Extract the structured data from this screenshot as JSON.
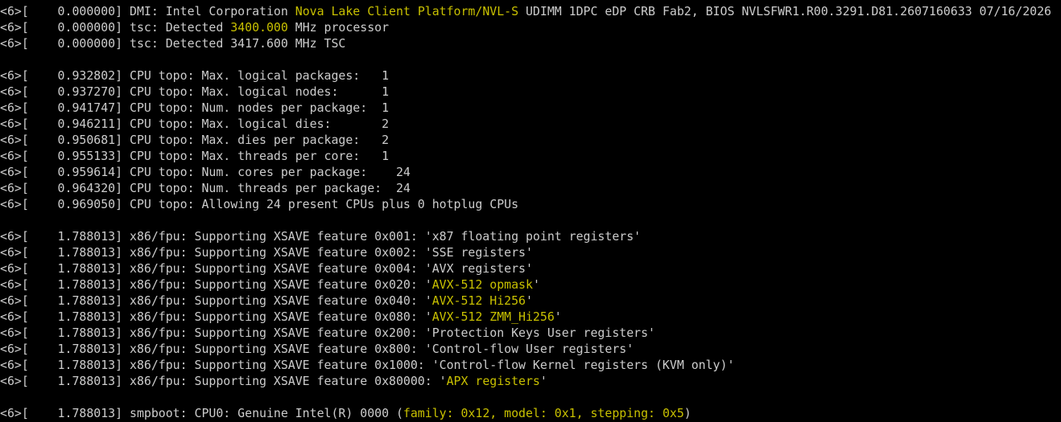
{
  "terminal": {
    "highlight_color": "#c8c000",
    "text_color": "#cccccc",
    "background_color": "#000000",
    "lines": [
      [
        {
          "t": "<6>[    0.000000] DMI: Intel Corporation "
        },
        {
          "t": "Nova Lake Client Platform/NVL-S",
          "hl": true
        },
        {
          "t": " UDIMM 1DPC eDP CRB Fab2, BIOS NVLSFWR1.R00.3291.D81.2607160633 07/16/2026"
        }
      ],
      [
        {
          "t": "<6>[    0.000000] tsc: Detected "
        },
        {
          "t": "3400.000",
          "hl": true
        },
        {
          "t": " MHz processor"
        }
      ],
      [
        {
          "t": "<6>[    0.000000] tsc: Detected 3417.600 MHz TSC"
        }
      ],
      [],
      [
        {
          "t": "<6>[    0.932802] CPU topo: Max. logical packages:   1"
        }
      ],
      [
        {
          "t": "<6>[    0.937270] CPU topo: Max. logical nodes:      1"
        }
      ],
      [
        {
          "t": "<6>[    0.941747] CPU topo: Num. nodes per package:  1"
        }
      ],
      [
        {
          "t": "<6>[    0.946211] CPU topo: Max. logical dies:       2"
        }
      ],
      [
        {
          "t": "<6>[    0.950681] CPU topo: Max. dies per package:   2"
        }
      ],
      [
        {
          "t": "<6>[    0.955133] CPU topo: Max. threads per core:   1"
        }
      ],
      [
        {
          "t": "<6>[    0.959614] CPU topo: Num. cores per package:    24"
        }
      ],
      [
        {
          "t": "<6>[    0.964320] CPU topo: Num. threads per package:  24"
        }
      ],
      [
        {
          "t": "<6>[    0.969050] CPU topo: Allowing 24 present CPUs plus 0 hotplug CPUs"
        }
      ],
      [],
      [
        {
          "t": "<6>[    1.788013] x86/fpu: Supporting XSAVE feature 0x001: 'x87 floating point registers'"
        }
      ],
      [
        {
          "t": "<6>[    1.788013] x86/fpu: Supporting XSAVE feature 0x002: 'SSE registers'"
        }
      ],
      [
        {
          "t": "<6>[    1.788013] x86/fpu: Supporting XSAVE feature 0x004: 'AVX registers'"
        }
      ],
      [
        {
          "t": "<6>[    1.788013] x86/fpu: Supporting XSAVE feature 0x020: '"
        },
        {
          "t": "AVX-512 opmask",
          "hl": true
        },
        {
          "t": "'"
        }
      ],
      [
        {
          "t": "<6>[    1.788013] x86/fpu: Supporting XSAVE feature 0x040: '"
        },
        {
          "t": "AVX-512 Hi256",
          "hl": true
        },
        {
          "t": "'"
        }
      ],
      [
        {
          "t": "<6>[    1.788013] x86/fpu: Supporting XSAVE feature 0x080: '"
        },
        {
          "t": "AVX-512 ZMM_Hi256",
          "hl": true
        },
        {
          "t": "'"
        }
      ],
      [
        {
          "t": "<6>[    1.788013] x86/fpu: Supporting XSAVE feature 0x200: 'Protection Keys User registers'"
        }
      ],
      [
        {
          "t": "<6>[    1.788013] x86/fpu: Supporting XSAVE feature 0x800: 'Control-flow User registers'"
        }
      ],
      [
        {
          "t": "<6>[    1.788013] x86/fpu: Supporting XSAVE feature 0x1000: 'Control-flow Kernel registers (KVM only)'"
        }
      ],
      [
        {
          "t": "<6>[    1.788013] x86/fpu: Supporting XSAVE feature 0x80000: '"
        },
        {
          "t": "APX registers",
          "hl": true
        },
        {
          "t": "'"
        }
      ],
      [],
      [
        {
          "t": "<6>[    1.788013] smpboot: CPU0: Genuine Intel(R) 0000 ("
        },
        {
          "t": "family: 0x12, model: 0x1, stepping: 0x5",
          "hl": true
        },
        {
          "t": ")"
        }
      ]
    ]
  }
}
